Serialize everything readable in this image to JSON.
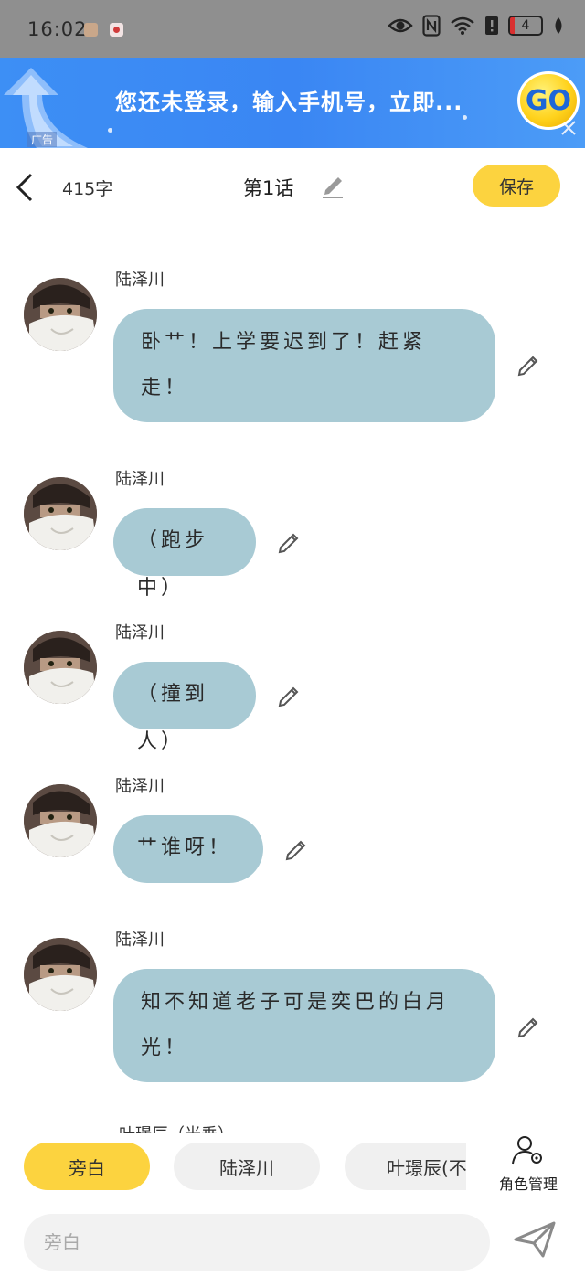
{
  "status_bar": {
    "time": "16:02",
    "battery": "4"
  },
  "ad": {
    "text": "您还未登录，输入手机号，立即...",
    "tag": "广告",
    "go_label": "GO"
  },
  "header": {
    "word_count": "415字",
    "chapter_title": "第1话",
    "save_label": "保存"
  },
  "messages": [
    {
      "speaker": "陆泽川",
      "text": "卧艹！上学要迟到了！赶紧走！"
    },
    {
      "speaker": "陆泽川",
      "text": "（跑步中）"
    },
    {
      "speaker": "陆泽川",
      "text": "（撞到人）"
    },
    {
      "speaker": "陆泽川",
      "text": "艹谁呀！"
    },
    {
      "speaker": "陆泽川",
      "text": "知不知道老子可是奕巴的白月光！"
    }
  ],
  "peek_speaker": "叶璟辰（光乗）",
  "roles": [
    {
      "label": "旁白",
      "active": true
    },
    {
      "label": "陆泽川",
      "active": false
    },
    {
      "label": "叶璟辰(不",
      "active": false
    }
  ],
  "role_manage_label": "角色管理",
  "input": {
    "placeholder": "旁白"
  },
  "colors": {
    "accent": "#fcd33f",
    "bubble": "#a8cad4",
    "status_bar": "#8f8f8f",
    "ad_blue": "#3d8ff5"
  }
}
